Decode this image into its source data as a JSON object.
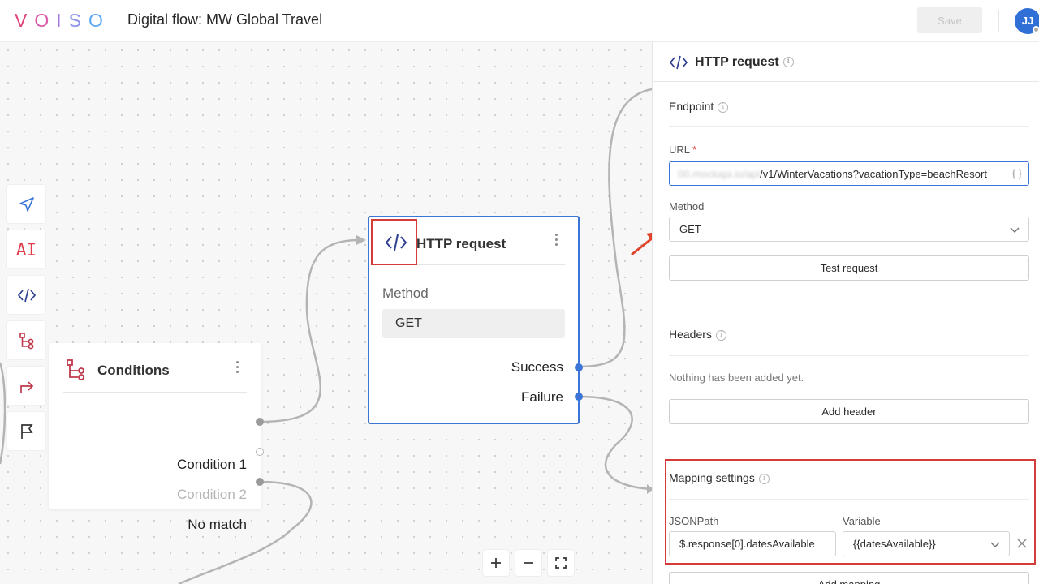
{
  "app": {
    "logo_letters": [
      "V",
      "O",
      "I",
      "S",
      "O"
    ],
    "title": "Digital flow: MW Global Travel",
    "save_label": "Save",
    "avatar_initials": "JJ"
  },
  "toolbox": {
    "icons": [
      "send-icon",
      "ai-icon",
      "code-icon",
      "branch-icon",
      "redirect-icon",
      "flag-icon"
    ],
    "ai_text": "AI"
  },
  "canvas": {
    "conditions_node": {
      "title": "Conditions",
      "outputs": [
        {
          "label": "Condition 1",
          "connected": true
        },
        {
          "label": "Condition 2",
          "connected": false
        },
        {
          "label": "No match",
          "connected": true
        }
      ]
    },
    "http_node": {
      "title": "HTTP request",
      "method_label": "Method",
      "method_value": "GET",
      "outputs": [
        {
          "label": "Success"
        },
        {
          "label": "Failure"
        }
      ]
    },
    "zoom_controls": [
      "zoom-in",
      "zoom-out",
      "fit-screen"
    ]
  },
  "panel": {
    "title": "HTTP request",
    "endpoint": {
      "title": "Endpoint",
      "url_label": "URL",
      "url_required_mark": "*",
      "url_hidden_part": "00.mockapi.io/api",
      "url_visible_part": "/v1/WinterVacations?vacationType=beachResort",
      "braces": "{ }",
      "method_label": "Method",
      "method_value": "GET",
      "test_button": "Test request"
    },
    "headers": {
      "title": "Headers",
      "empty_text": "Nothing has been added yet.",
      "add_button": "Add header"
    },
    "mapping": {
      "title": "Mapping settings",
      "jsonpath_label": "JSONPath",
      "jsonpath_value": "$.response[0].datesAvailable",
      "variable_label": "Variable",
      "variable_value": "{{datesAvailable}}",
      "add_button": "Add mapping"
    }
  },
  "colors": {
    "accent": "#3b75d8",
    "highlight": "#d63b3b",
    "icon_red": "#c0394b",
    "icon_navy": "#2e3f8f"
  }
}
